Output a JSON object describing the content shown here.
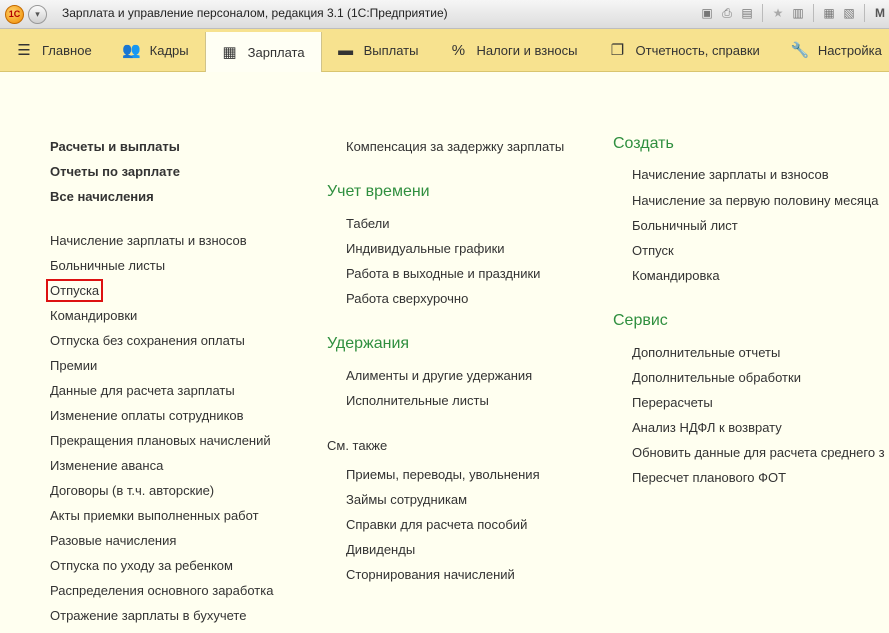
{
  "window": {
    "title": "Зарплата и управление персоналом, редакция 3.1  (1С:Предприятие)",
    "logo_text": "1С"
  },
  "toolbar_icons": [
    "save-icon",
    "print-icon",
    "preview-icon",
    "favorites-icon",
    "history-icon",
    "calculator-icon",
    "calendar-icon",
    "m-icon"
  ],
  "sections": [
    {
      "label": "Главное",
      "icon": "menu-icon"
    },
    {
      "label": "Кадры",
      "icon": "people-icon"
    },
    {
      "label": "Зарплата",
      "icon": "calculator-icon",
      "active": true
    },
    {
      "label": "Выплаты",
      "icon": "wallet-icon"
    },
    {
      "label": "Налоги и взносы",
      "icon": "percent-icon"
    },
    {
      "label": "Отчетность, справки",
      "icon": "documents-icon"
    },
    {
      "label": "Настройка",
      "icon": "wrench-icon"
    }
  ],
  "left_column": {
    "main_links": [
      "Расчеты и выплаты",
      "Отчеты по зарплате",
      "Все начисления"
    ],
    "items": [
      "Начисление зарплаты и взносов",
      "Больничные листы",
      "Отпуска",
      "Командировки",
      "Отпуска без сохранения оплаты",
      "Премии",
      "Данные для расчета зарплаты",
      "Изменение оплаты сотрудников",
      "Прекращения плановых начислений",
      "Изменение аванса",
      "Договоры (в т.ч. авторские)",
      "Акты приемки выполненных работ",
      "Разовые начисления",
      "Отпуска по уходу за ребенком",
      "Распределения основного заработка",
      "Отражение зарплаты в бухучете"
    ]
  },
  "middle_column": {
    "top_item": "Компенсация за задержку зарплаты",
    "time_title": "Учет времени",
    "time_items": [
      "Табели",
      "Индивидуальные графики",
      "Работа в выходные и праздники",
      "Работа сверхурочно"
    ],
    "deductions_title": "Удержания",
    "deductions_items": [
      "Алименты и другие удержания",
      "Исполнительные листы"
    ],
    "see_also_title": "См. также",
    "see_also_items": [
      "Приемы, переводы, увольнения",
      "Займы сотрудникам",
      "Справки для расчета пособий",
      "Дивиденды",
      "Сторнирования начислений"
    ]
  },
  "right_column": {
    "create_title": "Создать",
    "create_items": [
      "Начисление зарплаты и взносов",
      "Начисление за первую половину месяца",
      "Больничный лист",
      "Отпуск",
      "Командировка"
    ],
    "service_title": "Сервис",
    "service_items": [
      "Дополнительные отчеты",
      "Дополнительные обработки",
      "Перерасчеты",
      "Анализ НДФЛ к возврату",
      "Обновить данные для расчета среднего з",
      "Пересчет планового ФОТ"
    ]
  },
  "colors": {
    "section_bar": "#f7e28f",
    "group_title": "#2f8f3f",
    "highlight": "#dd1111",
    "content_bg": "#fffff0"
  }
}
